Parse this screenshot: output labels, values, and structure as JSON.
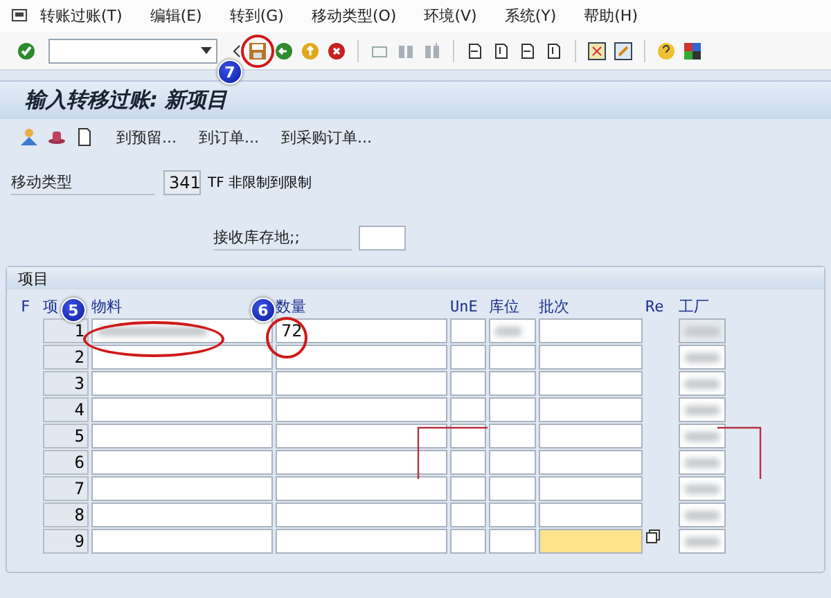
{
  "menu": [
    "转账过账(T)",
    "编辑(E)",
    "转到(G)",
    "移动类型(O)",
    "环境(V)",
    "系统(Y)",
    "帮助(H)"
  ],
  "title": "输入转移过账: 新项目",
  "app_toolbar": [
    "到预留...",
    "到订单...",
    "到采购订单..."
  ],
  "movement_type": {
    "label": "移动类型",
    "value": "341",
    "text": "TF 非限制到限制"
  },
  "receiving_storage": {
    "label": "接收库存地;;"
  },
  "items": {
    "title": "项目",
    "columns": [
      "F",
      "项",
      "物料",
      "数量",
      "UnE",
      "库位",
      "批次",
      "Re",
      "工厂"
    ],
    "rows": [
      {
        "no": "1",
        "quantity": "72",
        "material_blurred": true,
        "location_blurred": true,
        "plant_blurred": true,
        "focused": false
      },
      {
        "no": "2",
        "material_blurred": false,
        "location_blurred": false,
        "plant_blurred": true,
        "focused": false
      },
      {
        "no": "3",
        "material_blurred": false,
        "location_blurred": false,
        "plant_blurred": true,
        "focused": false
      },
      {
        "no": "4",
        "material_blurred": false,
        "location_blurred": false,
        "plant_blurred": true,
        "focused": false
      },
      {
        "no": "5",
        "material_blurred": false,
        "location_blurred": false,
        "plant_blurred": true,
        "focused": false
      },
      {
        "no": "6",
        "material_blurred": false,
        "location_blurred": false,
        "plant_blurred": true,
        "focused": false
      },
      {
        "no": "7",
        "material_blurred": false,
        "location_blurred": false,
        "plant_blurred": true,
        "focused": false
      },
      {
        "no": "8",
        "material_blurred": false,
        "location_blurred": false,
        "plant_blurred": true,
        "focused": false
      },
      {
        "no": "9",
        "material_blurred": false,
        "location_blurred": false,
        "plant_blurred": true,
        "focused": true
      }
    ]
  },
  "annotations": [
    {
      "label": "7"
    },
    {
      "label": "5"
    },
    {
      "label": "6"
    }
  ]
}
